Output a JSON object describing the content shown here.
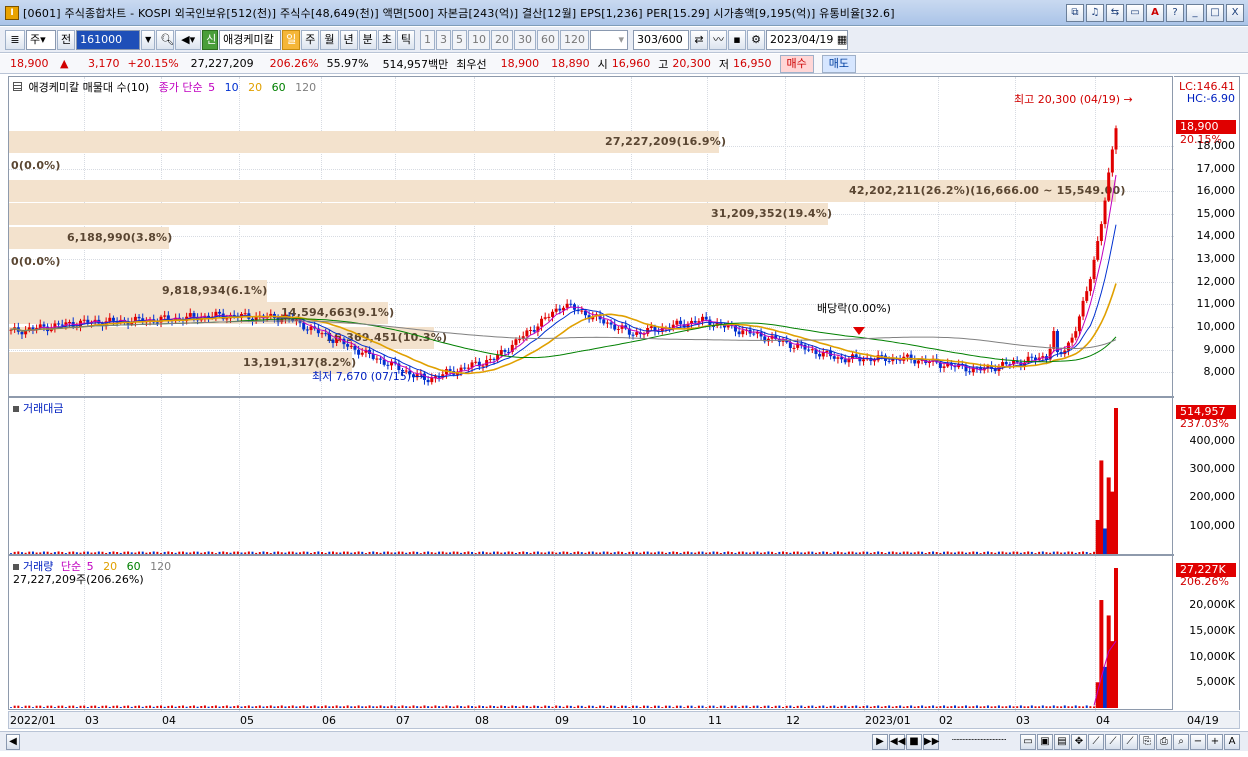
{
  "window": {
    "title": "[0601] 주식종합차트 - KOSPI 외국인보유[512(천)] 주식수[48,649(천)] 액면[500] 자본금[243(억)] 결산[12월] EPS[1,236] PER[15.29] 시가총액[9,195(억)] 유통비율[32.6]",
    "buttons": [
      "⧉",
      "♫",
      "⇆",
      "▭",
      "A",
      "?",
      "_",
      "□",
      "X"
    ]
  },
  "toolbar": {
    "mode": "주",
    "prev": "전",
    "code": "161000",
    "stock_name": "애경케미칼",
    "periods": [
      "일",
      "주",
      "월",
      "년",
      "분",
      "초",
      "틱"
    ],
    "active_period": "일",
    "intervals": [
      "1",
      "3",
      "5",
      "10",
      "20",
      "30",
      "60",
      "120"
    ],
    "count": "303",
    "count_total": "/600",
    "date": "2023/04/19"
  },
  "info": {
    "price": "18,900",
    "change": "3,170",
    "change_pct": "+20.15%",
    "volume": "27,227,209",
    "volume_pct": "206.26%",
    "turnover": "55.97%",
    "amount": "514,957백만",
    "best_label": "최우선",
    "ask": "18,900",
    "bid": "18,890",
    "open_label": "시",
    "open": "16,960",
    "high_label": "고",
    "high": "20,300",
    "low_label": "저",
    "low": "16,950",
    "buy": "매수",
    "sell": "매도"
  },
  "price_pane": {
    "legend_title": "애경케미칼 매물대 수(10)",
    "ma_label": "종가 단순",
    "ma_periods": [
      "5",
      "10",
      "20",
      "60",
      "120"
    ],
    "ma_colors": [
      "#c000c0",
      "#0030d0",
      "#e0a000",
      "#008000",
      "#808080"
    ],
    "lc": "LC:146.41",
    "hc": "HC:-6.90",
    "last_price": "18,900",
    "last_pct": "20.15%",
    "yticks": [
      "18,000",
      "17,000",
      "16,000",
      "15,000",
      "14,000",
      "13,000",
      "12,000",
      "11,000",
      "10,000",
      "9,000",
      "8,000"
    ],
    "high_anno": "최고 20,300 (04/19)",
    "low_anno": "최저 7,670 (07/15)",
    "dividend": "배당락(0.00%)",
    "volume_profile": [
      {
        "label": "27,227,209(16.9%)"
      },
      {
        "label": "0(0.0%)"
      },
      {
        "label": "42,202,211(26.2%)(16,666.00 ~ 15,549.00)"
      },
      {
        "label": "31,209,352(19.4%)"
      },
      {
        "label": "6,188,990(3.8%)"
      },
      {
        "label": "0(0.0%)"
      },
      {
        "label": "9,818,934(6.1%)"
      },
      {
        "label": "14,594,663(9.1%)"
      },
      {
        "label": "16,369,451(10.3%)"
      },
      {
        "label": "13,191,317(8.2%)"
      }
    ]
  },
  "amount_pane": {
    "legend": "거래대금",
    "last": "514,957",
    "last_pct": "237.03%",
    "yticks": [
      "400,000",
      "300,000",
      "200,000",
      "100,000"
    ]
  },
  "volume_pane": {
    "legend": "거래량",
    "ma_label": "단순",
    "ma_periods": [
      "5",
      "20",
      "60",
      "120"
    ],
    "ma_colors": [
      "#c000c0",
      "#e0a000",
      "#008000",
      "#808080"
    ],
    "sub": "27,227,209주(206.26%)",
    "last": "27,227K",
    "last_pct": "206.26%",
    "yticks": [
      "20,000K",
      "15,000K",
      "10,000K",
      "5,000K"
    ]
  },
  "xaxis": {
    "labels": [
      "2022/01",
      "03",
      "04",
      "05",
      "06",
      "07",
      "08",
      "09",
      "10",
      "11",
      "12",
      "2023/01",
      "02",
      "03",
      "04"
    ],
    "end": "04/19"
  },
  "chart_data": {
    "type": "candlestick",
    "title": "애경케미칼",
    "x_range": [
      "2022/01",
      "2023/04/19"
    ],
    "price_ylim": [
      7500,
      20300
    ],
    "price_path": [
      [
        "2022/01",
        9800
      ],
      [
        "2022/02",
        10200
      ],
      [
        "2022/03",
        10300
      ],
      [
        "2022/04",
        10500
      ],
      [
        "2022/05",
        10400
      ],
      [
        "2022/06",
        9000
      ],
      [
        "2022/07",
        7670
      ],
      [
        "2022/08",
        8600
      ],
      [
        "2022/09",
        11000
      ],
      [
        "2022/10",
        9700
      ],
      [
        "2022/11",
        10300
      ],
      [
        "2022/12",
        9500
      ],
      [
        "2023/01",
        8600
      ],
      [
        "2023/02",
        8600
      ],
      [
        "2023/03",
        8100
      ],
      [
        "2023/04",
        8700
      ],
      [
        "2023/04/19",
        18900
      ]
    ],
    "amount_ylim": [
      0,
      514957
    ],
    "recent_amount": [
      120000,
      330000,
      90000,
      270000,
      220000,
      514957
    ],
    "volume_ylim": [
      0,
      27227000
    ],
    "recent_volume": [
      5000000,
      21000000,
      8000000,
      18000000,
      13000000,
      27227209
    ]
  }
}
